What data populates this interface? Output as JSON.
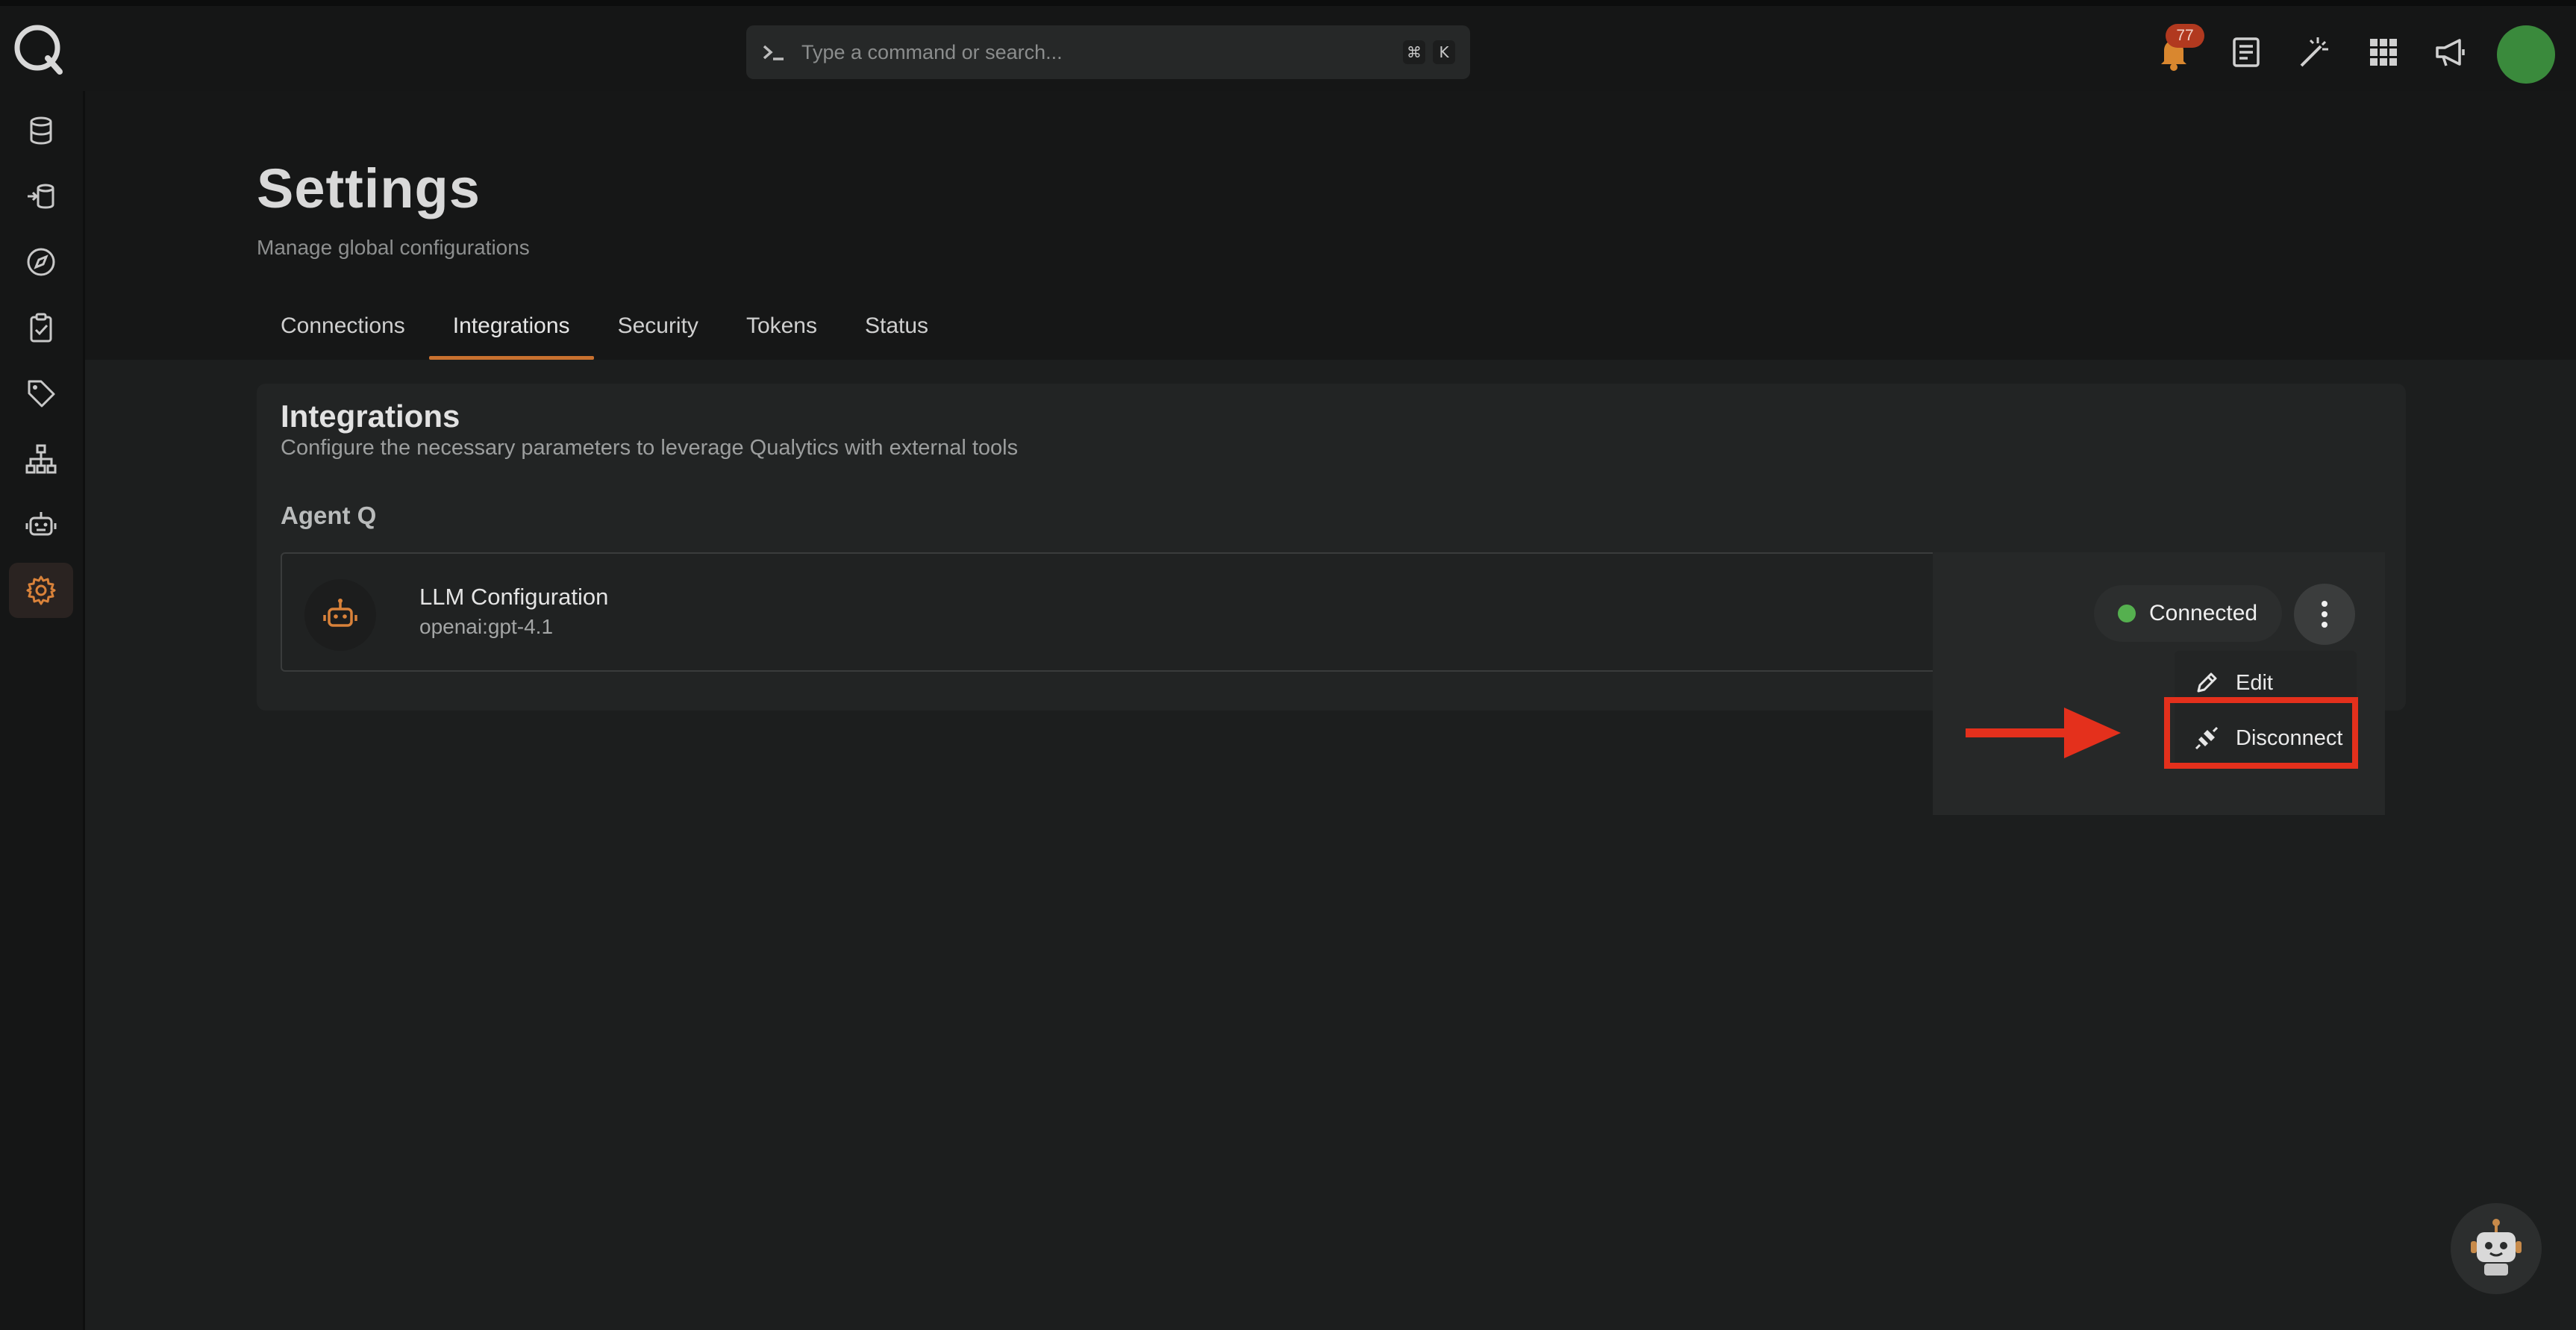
{
  "search": {
    "placeholder": "Type a command or search...",
    "shortcut_mod": "⌘",
    "shortcut_key": "K"
  },
  "notifications": {
    "count": "77"
  },
  "page": {
    "title": "Settings",
    "subtitle": "Manage global configurations"
  },
  "tabs": [
    {
      "label": "Connections"
    },
    {
      "label": "Integrations",
      "active": true
    },
    {
      "label": "Security"
    },
    {
      "label": "Tokens"
    },
    {
      "label": "Status"
    }
  ],
  "card": {
    "title": "Integrations",
    "description": "Configure the necessary parameters to leverage Qualytics with external tools",
    "section": "Agent Q",
    "item": {
      "name": "LLM Configuration",
      "model": "openai:gpt-4.1",
      "status": "Connected",
      "icon": "robot-icon"
    }
  },
  "menu": {
    "items": [
      {
        "label": "Edit",
        "icon": "pencil-icon"
      },
      {
        "label": "Disconnect",
        "icon": "unplug-icon"
      }
    ]
  },
  "sidebar": {
    "items": [
      "database-icon",
      "data-ingest-icon",
      "compass-icon",
      "clipboard-check-icon",
      "tag-icon",
      "hierarchy-icon",
      "robot-icon",
      "gear-icon"
    ],
    "active": "gear-icon"
  },
  "colors": {
    "accent": "#c9712f",
    "connected": "#55b04f",
    "highlight": "#e4301c",
    "avatar": "#3a8a3c"
  }
}
